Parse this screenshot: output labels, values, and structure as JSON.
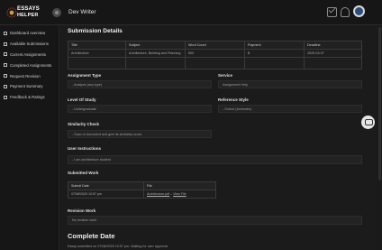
{
  "app": {
    "logo_line1": "ESSAYS",
    "logo_line2": "HELPER",
    "header_title": "Dev Writer"
  },
  "sidebar": {
    "items": [
      {
        "label": "Dashboard overview"
      },
      {
        "label": "Available Submissions"
      },
      {
        "label": "Current Assignments"
      },
      {
        "label": "Completed Assignments"
      },
      {
        "label": "Request Revision"
      },
      {
        "label": "Payment Summary"
      },
      {
        "label": "Feedback & Ratings"
      }
    ]
  },
  "details": {
    "title": "Submission Details",
    "columns": [
      "Title",
      "Subject",
      "Word Count",
      "Payment",
      "Deadline"
    ],
    "row": [
      "Architecture",
      "Architecture, Building and Planning",
      "500",
      "$",
      "2025-03-07"
    ]
  },
  "fields": {
    "assignment_type_label": "Assignment Type",
    "assignment_type_value": "- Analysis (any type)",
    "service_label": "Service",
    "service_value": "Assignment Help",
    "level_label": "Level Of Study",
    "level_value": "- Undergraduate",
    "reference_label": "Reference Style",
    "reference_value": "- Oxford (footnotes)",
    "similarity_label": "Similarity Check",
    "similarity_value": "- Scan of document and give its similarity score.",
    "instructions_label": "User Instructions",
    "instructions_value": "- I am architecture student"
  },
  "submitted_work": {
    "title": "Submitted Work",
    "columns": [
      "Submit Date",
      "File"
    ],
    "row": {
      "date": "07/08/2025 10:57 pm",
      "file": "Architecture.pdf",
      "view": "View File"
    }
  },
  "revision": {
    "title": "Revision Work",
    "value": "No revision work"
  },
  "complete": {
    "title": "Complete Date",
    "value": "Essay submitted on 07/08/2025 10:57 pm. Waiting for user approval."
  },
  "colors": {
    "background": "#1b1b1b",
    "panel": "#161616",
    "field": "#232323",
    "avatar": "#2b4c7e"
  },
  "icons": [
    "mail-icon",
    "bell-icon",
    "chat-icon",
    "collapse-icon"
  ]
}
